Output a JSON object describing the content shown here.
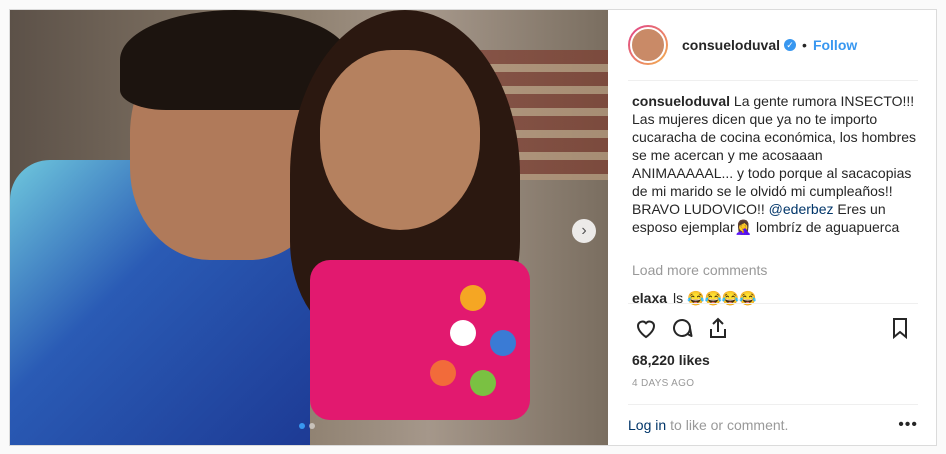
{
  "post": {
    "username": "consueloduval",
    "follow_label": "Follow",
    "separator": "•",
    "caption": {
      "username": "consueloduval",
      "text_before": " La gente rumora INSECTO!!! Las mujeres dicen que ya no te importo cucaracha de cocina económica, los hombres se me acercan y me acosaaan ANIMAAAAAL... y todo porque al sacacopias de mi marido se le olvidó mi cumpleaños!! BRAVO LUDOVICO!! ",
      "mention": "@ederbez",
      "text_after": " Eres un esposo ejemplar⁣🤦‍♀️ lombríz de aguapuerca"
    },
    "load_more": "Load more comments",
    "comment": {
      "username": "elaxa",
      "text": "ls 😂😂😂😂"
    },
    "likes": "68,220 likes",
    "time": "4 DAYS AGO",
    "footer": {
      "login": "Log in",
      "rest": "to like or comment."
    },
    "menu": "•••"
  },
  "carousel": {
    "next": "›",
    "slides": 2,
    "active": 0
  },
  "icons": [
    "verified-icon",
    "heart-icon",
    "comment-icon",
    "share-icon",
    "bookmark-icon",
    "more-options-icon",
    "chevron-right-icon"
  ],
  "colors": {
    "link": "#3897f0",
    "mention": "#003569"
  }
}
